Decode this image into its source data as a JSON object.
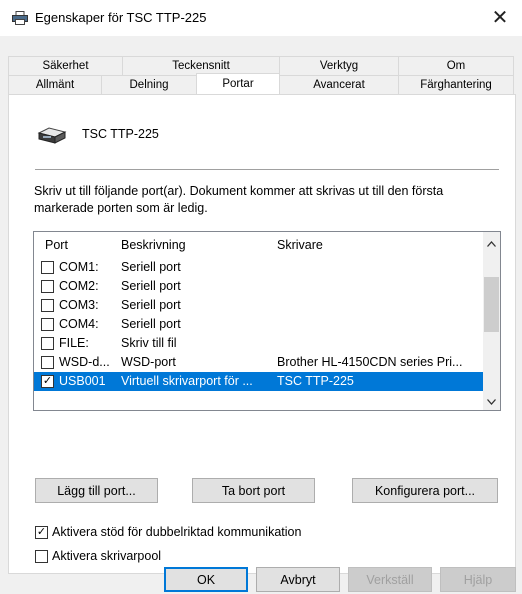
{
  "window": {
    "title": "Egenskaper för TSC TTP-225",
    "close_glyph": "✕",
    "icon": "printer-icon"
  },
  "tabs": {
    "upper": [
      {
        "label": "Säkerhet"
      },
      {
        "label": "Teckensnitt"
      },
      {
        "label": "Verktyg"
      },
      {
        "label": "Om"
      }
    ],
    "lower": [
      {
        "label": "Allmänt"
      },
      {
        "label": "Delning"
      },
      {
        "label": "Portar"
      },
      {
        "label": "Avancerat"
      },
      {
        "label": "Färghantering"
      }
    ],
    "active": "Portar"
  },
  "printer": {
    "name": "TSC TTP-225"
  },
  "description": "Skriv ut till följande port(ar). Dokument kommer att skrivas ut till den första markerade porten som är ledig.",
  "port_list": {
    "headers": {
      "port": "Port",
      "desc": "Beskrivning",
      "printer": "Skrivare"
    },
    "rows": [
      {
        "checked": false,
        "port": "COM1:",
        "desc": "Seriell port",
        "printer": ""
      },
      {
        "checked": false,
        "port": "COM2:",
        "desc": "Seriell port",
        "printer": ""
      },
      {
        "checked": false,
        "port": "COM3:",
        "desc": "Seriell port",
        "printer": ""
      },
      {
        "checked": false,
        "port": "COM4:",
        "desc": "Seriell port",
        "printer": ""
      },
      {
        "checked": false,
        "port": "FILE:",
        "desc": "Skriv till fil",
        "printer": ""
      },
      {
        "checked": false,
        "port": "WSD-d...",
        "desc": "WSD-port",
        "printer": "Brother HL-4150CDN series Pri..."
      },
      {
        "checked": true,
        "port": "USB001",
        "desc": "Virtuell skrivarport för ...",
        "printer": "TSC TTP-225",
        "selected": true
      }
    ]
  },
  "port_buttons": {
    "add": "Lägg till port...",
    "remove": "Ta bort port",
    "configure": "Konfigurera port..."
  },
  "options": {
    "bidirectional": {
      "label": "Aktivera stöd för dubbelriktad kommunikation",
      "checked": true
    },
    "pool": {
      "label": "Aktivera skrivarpool",
      "checked": false
    }
  },
  "dialog_buttons": {
    "ok": "OK",
    "cancel": "Avbryt",
    "apply": "Verkställ",
    "help": "Hjälp"
  },
  "check_glyph": "✓",
  "colors": {
    "selection": "#0078d7",
    "selection_text": "#ffffff",
    "disabled_text": "#a0a0a0"
  }
}
